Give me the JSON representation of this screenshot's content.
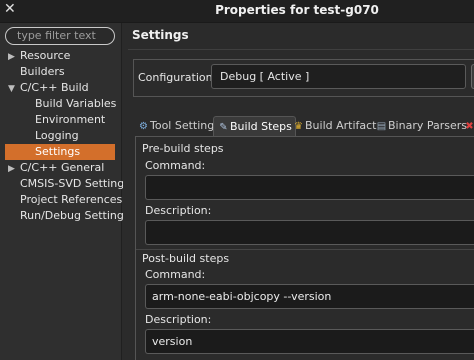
{
  "window": {
    "title": "Properties for test-g070",
    "close_glyph": "✕"
  },
  "sidebar": {
    "filter_placeholder": "type filter text",
    "items": [
      {
        "label": "Resource",
        "arrow": "▶"
      },
      {
        "label": "Builders"
      },
      {
        "label": "C/C++ Build",
        "arrow": "▼"
      },
      {
        "label": "Build Variables"
      },
      {
        "label": "Environment"
      },
      {
        "label": "Logging"
      },
      {
        "label": "Settings"
      },
      {
        "label": "C/C++ General",
        "arrow": "▶"
      },
      {
        "label": "CMSIS-SVD Settings"
      },
      {
        "label": "Project References"
      },
      {
        "label": "Run/Debug Settings"
      }
    ]
  },
  "main": {
    "title": "Settings",
    "configuration_label": "Configuration:",
    "configuration_value": "Debug  [ Active ]",
    "tabs": [
      {
        "label": "Tool Settings",
        "icon": "tool-settings-icon"
      },
      {
        "label": "Build Steps",
        "icon": "build-steps-icon"
      },
      {
        "label": "Build Artifact",
        "icon": "build-artifact-icon"
      },
      {
        "label": "Binary Parsers",
        "icon": "binary-parsers-icon"
      }
    ],
    "pre_build": {
      "group": "Pre-build steps",
      "command_label": "Command:",
      "command_value": "",
      "description_label": "Description:",
      "description_value": ""
    },
    "post_build": {
      "group": "Post-build steps",
      "command_label": "Command:",
      "command_value": "arm-none-eabi-objcopy --version",
      "description_label": "Description:",
      "description_value": "version"
    }
  }
}
